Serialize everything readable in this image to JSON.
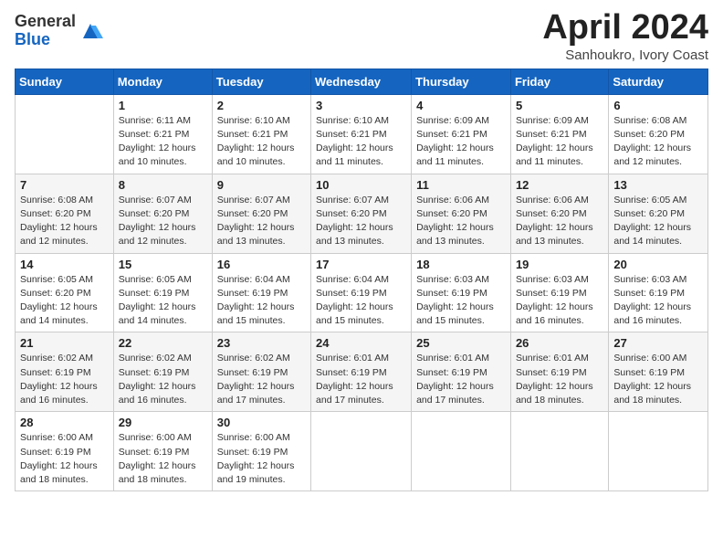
{
  "header": {
    "logo_general": "General",
    "logo_blue": "Blue",
    "title": "April 2024",
    "location": "Sanhoukro, Ivory Coast"
  },
  "days_of_week": [
    "Sunday",
    "Monday",
    "Tuesday",
    "Wednesday",
    "Thursday",
    "Friday",
    "Saturday"
  ],
  "weeks": [
    [
      {
        "day": "",
        "info": ""
      },
      {
        "day": "1",
        "info": "Sunrise: 6:11 AM\nSunset: 6:21 PM\nDaylight: 12 hours\nand 10 minutes."
      },
      {
        "day": "2",
        "info": "Sunrise: 6:10 AM\nSunset: 6:21 PM\nDaylight: 12 hours\nand 10 minutes."
      },
      {
        "day": "3",
        "info": "Sunrise: 6:10 AM\nSunset: 6:21 PM\nDaylight: 12 hours\nand 11 minutes."
      },
      {
        "day": "4",
        "info": "Sunrise: 6:09 AM\nSunset: 6:21 PM\nDaylight: 12 hours\nand 11 minutes."
      },
      {
        "day": "5",
        "info": "Sunrise: 6:09 AM\nSunset: 6:21 PM\nDaylight: 12 hours\nand 11 minutes."
      },
      {
        "day": "6",
        "info": "Sunrise: 6:08 AM\nSunset: 6:20 PM\nDaylight: 12 hours\nand 12 minutes."
      }
    ],
    [
      {
        "day": "7",
        "info": "Sunrise: 6:08 AM\nSunset: 6:20 PM\nDaylight: 12 hours\nand 12 minutes."
      },
      {
        "day": "8",
        "info": "Sunrise: 6:07 AM\nSunset: 6:20 PM\nDaylight: 12 hours\nand 12 minutes."
      },
      {
        "day": "9",
        "info": "Sunrise: 6:07 AM\nSunset: 6:20 PM\nDaylight: 12 hours\nand 13 minutes."
      },
      {
        "day": "10",
        "info": "Sunrise: 6:07 AM\nSunset: 6:20 PM\nDaylight: 12 hours\nand 13 minutes."
      },
      {
        "day": "11",
        "info": "Sunrise: 6:06 AM\nSunset: 6:20 PM\nDaylight: 12 hours\nand 13 minutes."
      },
      {
        "day": "12",
        "info": "Sunrise: 6:06 AM\nSunset: 6:20 PM\nDaylight: 12 hours\nand 13 minutes."
      },
      {
        "day": "13",
        "info": "Sunrise: 6:05 AM\nSunset: 6:20 PM\nDaylight: 12 hours\nand 14 minutes."
      }
    ],
    [
      {
        "day": "14",
        "info": "Sunrise: 6:05 AM\nSunset: 6:20 PM\nDaylight: 12 hours\nand 14 minutes."
      },
      {
        "day": "15",
        "info": "Sunrise: 6:05 AM\nSunset: 6:19 PM\nDaylight: 12 hours\nand 14 minutes."
      },
      {
        "day": "16",
        "info": "Sunrise: 6:04 AM\nSunset: 6:19 PM\nDaylight: 12 hours\nand 15 minutes."
      },
      {
        "day": "17",
        "info": "Sunrise: 6:04 AM\nSunset: 6:19 PM\nDaylight: 12 hours\nand 15 minutes."
      },
      {
        "day": "18",
        "info": "Sunrise: 6:03 AM\nSunset: 6:19 PM\nDaylight: 12 hours\nand 15 minutes."
      },
      {
        "day": "19",
        "info": "Sunrise: 6:03 AM\nSunset: 6:19 PM\nDaylight: 12 hours\nand 16 minutes."
      },
      {
        "day": "20",
        "info": "Sunrise: 6:03 AM\nSunset: 6:19 PM\nDaylight: 12 hours\nand 16 minutes."
      }
    ],
    [
      {
        "day": "21",
        "info": "Sunrise: 6:02 AM\nSunset: 6:19 PM\nDaylight: 12 hours\nand 16 minutes."
      },
      {
        "day": "22",
        "info": "Sunrise: 6:02 AM\nSunset: 6:19 PM\nDaylight: 12 hours\nand 16 minutes."
      },
      {
        "day": "23",
        "info": "Sunrise: 6:02 AM\nSunset: 6:19 PM\nDaylight: 12 hours\nand 17 minutes."
      },
      {
        "day": "24",
        "info": "Sunrise: 6:01 AM\nSunset: 6:19 PM\nDaylight: 12 hours\nand 17 minutes."
      },
      {
        "day": "25",
        "info": "Sunrise: 6:01 AM\nSunset: 6:19 PM\nDaylight: 12 hours\nand 17 minutes."
      },
      {
        "day": "26",
        "info": "Sunrise: 6:01 AM\nSunset: 6:19 PM\nDaylight: 12 hours\nand 18 minutes."
      },
      {
        "day": "27",
        "info": "Sunrise: 6:00 AM\nSunset: 6:19 PM\nDaylight: 12 hours\nand 18 minutes."
      }
    ],
    [
      {
        "day": "28",
        "info": "Sunrise: 6:00 AM\nSunset: 6:19 PM\nDaylight: 12 hours\nand 18 minutes."
      },
      {
        "day": "29",
        "info": "Sunrise: 6:00 AM\nSunset: 6:19 PM\nDaylight: 12 hours\nand 18 minutes."
      },
      {
        "day": "30",
        "info": "Sunrise: 6:00 AM\nSunset: 6:19 PM\nDaylight: 12 hours\nand 19 minutes."
      },
      {
        "day": "",
        "info": ""
      },
      {
        "day": "",
        "info": ""
      },
      {
        "day": "",
        "info": ""
      },
      {
        "day": "",
        "info": ""
      }
    ]
  ]
}
